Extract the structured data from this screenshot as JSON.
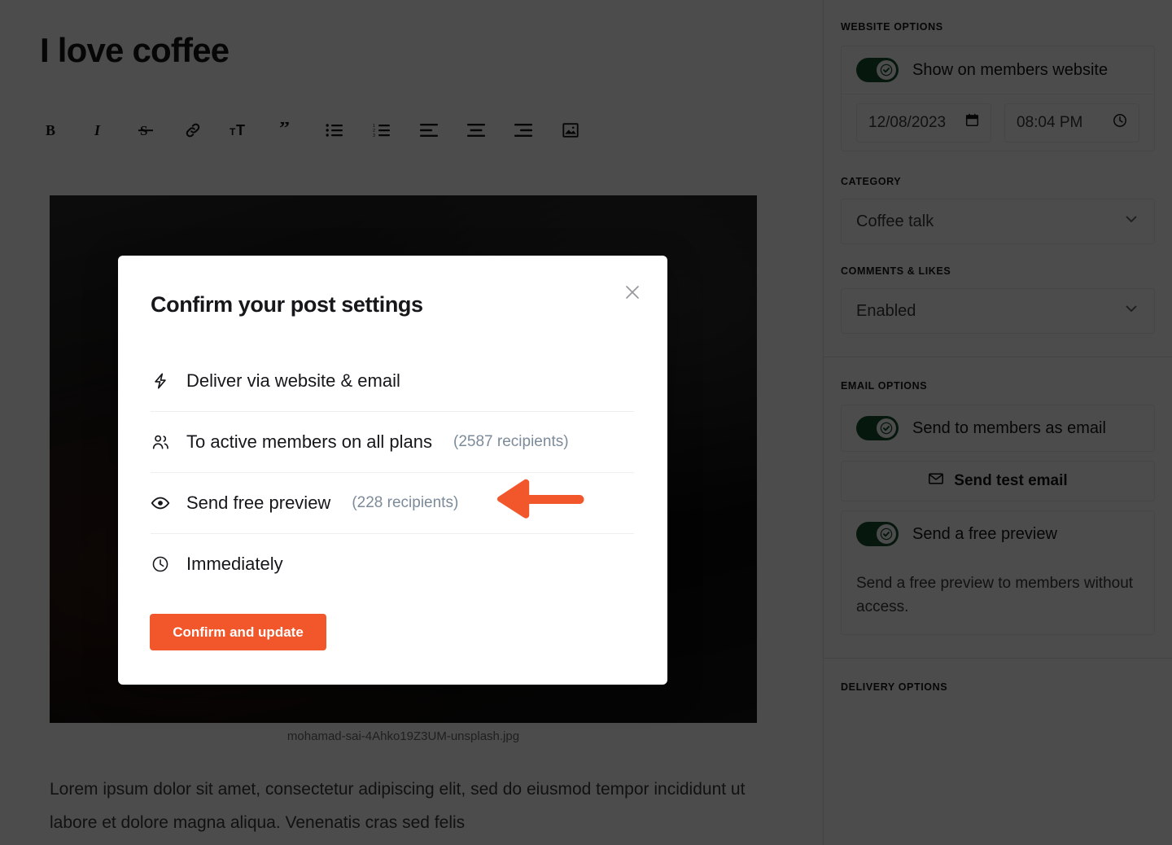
{
  "editor": {
    "post_title": "I love coffee",
    "toolbar": [
      {
        "name": "bold-icon",
        "label": "Bold"
      },
      {
        "name": "italic-icon",
        "label": "Italic"
      },
      {
        "name": "strikethrough-icon",
        "label": "Strikethrough"
      },
      {
        "name": "link-icon",
        "label": "Link"
      },
      {
        "name": "text-size-icon",
        "label": "Text size"
      },
      {
        "name": "quote-icon",
        "label": "Blockquote"
      },
      {
        "name": "bullet-list-icon",
        "label": "Bulleted list"
      },
      {
        "name": "numbered-list-icon",
        "label": "Numbered list"
      },
      {
        "name": "align-left-icon",
        "label": "Align left"
      },
      {
        "name": "align-center-icon",
        "label": "Align center"
      },
      {
        "name": "align-right-icon",
        "label": "Align right"
      },
      {
        "name": "image-icon",
        "label": "Insert image"
      }
    ],
    "image_caption": "mohamad-sai-4Ahko19Z3UM-unsplash.jpg",
    "body_text": "Lorem ipsum dolor sit amet, consectetur adipiscing elit, sed do eiusmod tempor incididunt ut labore et dolore magna aliqua. Venenatis cras sed felis"
  },
  "sidebar": {
    "website_options": {
      "heading": "WEBSITE OPTIONS",
      "show_on_site_label": "Show on members website",
      "show_on_site_enabled": true,
      "date_value": "12/08/2023",
      "time_value": "08:04 PM"
    },
    "category": {
      "heading": "CATEGORY",
      "selected": "Coffee talk"
    },
    "comments_likes": {
      "heading": "COMMENTS & LIKES",
      "selected": "Enabled"
    },
    "email_options": {
      "heading": "EMAIL OPTIONS",
      "send_as_email_label": "Send to members as email",
      "send_as_email_enabled": true,
      "send_test_email_label": "Send test email",
      "send_free_preview_label": "Send a free preview",
      "send_free_preview_enabled": true,
      "free_preview_help": "Send a free preview to members without access."
    },
    "delivery_options": {
      "heading": "DELIVERY OPTIONS"
    }
  },
  "modal": {
    "title": "Confirm your post settings",
    "close_label": "Close",
    "items": [
      {
        "icon": "lightning-bolt-icon",
        "text": "Deliver via website & email",
        "count": ""
      },
      {
        "icon": "members-icon",
        "text": "To active members on all plans",
        "count": "(2587 recipients)"
      },
      {
        "icon": "eye-icon",
        "text": "Send free preview",
        "count": "(228 recipients)"
      },
      {
        "icon": "clock-icon",
        "text": "Immediately",
        "count": ""
      }
    ],
    "confirm_label": "Confirm and update"
  },
  "annotation": {
    "arrow_name": "pointer-arrow-left",
    "arrow_color": "#f2562b"
  },
  "colors": {
    "accent": "#f2562b",
    "toggle_on": "#14512d",
    "muted_text": "#7c8b9a",
    "overlay": "rgba(0,0,0,0.70)"
  }
}
